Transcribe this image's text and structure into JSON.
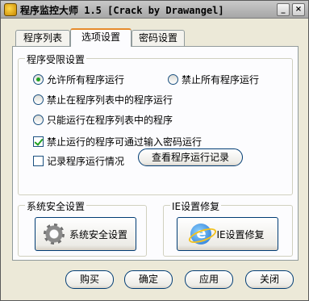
{
  "window": {
    "title": "程序监控大师 1.5 [Crack by Drawangel]",
    "controls": {
      "minimize": "_",
      "close": "×"
    }
  },
  "tabs": [
    {
      "label": "程序列表",
      "active": false
    },
    {
      "label": "选项设置",
      "active": true
    },
    {
      "label": "密码设置",
      "active": false
    }
  ],
  "restrict_group": {
    "title": "程序受限设置",
    "radio_allow_all": "允许所有程序运行",
    "radio_block_all": "禁止所有程序运行",
    "radio_block_in_list": "禁止在程序列表中的程序运行",
    "radio_only_list": "只能运行在程序列表中的程序",
    "check_password": "禁止运行的程序可通过输入密码运行",
    "check_log": "记录程序运行情况",
    "view_log_button": "查看程序运行记录",
    "selected_radio": "allow_all",
    "password_checked": true,
    "log_checked": false
  },
  "security_group": {
    "title": "系统安全设置",
    "button": "系统安全设置",
    "icon": "gear-icon"
  },
  "ie_group": {
    "title": "IE设置修复",
    "button": "IE设置修复",
    "icon": "ie-icon",
    "icon_glyph": "e"
  },
  "footer": {
    "buy": "购买",
    "ok": "确定",
    "apply": "应用",
    "close": "关闭"
  }
}
